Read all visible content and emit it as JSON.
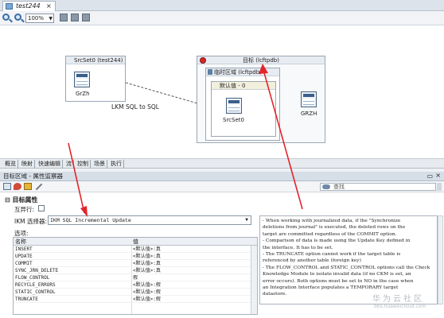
{
  "editor": {
    "tab_label": "test244",
    "tab_close": "×",
    "zoom_value": "100%"
  },
  "diagram": {
    "source_set": {
      "title": "SrcSet0 (test244)",
      "table_label": "GrZh"
    },
    "lkm_label": "LKM SQL to SQL",
    "target": {
      "title": "目标 (lcftpdb)",
      "staging_title": "临时区域 (lcftpdb)",
      "default_title": "默认值 - 0",
      "inner_table_label": "SrcSet0",
      "target_table_label": "GRZH"
    }
  },
  "view_tabs": [
    "概览",
    "映射",
    "快速编辑",
    "流",
    "控制",
    "场景",
    "执行"
  ],
  "properties_panel": {
    "header": "目标区域 - 属性监察器",
    "search_placeholder": "查找",
    "section_title": "目标属性",
    "mutex_label": "互异行:",
    "lkm_selector_label": "IKM 选择器:",
    "lkm_selected": "IKM SQL Incremental Update",
    "options_label": "选项:",
    "options_columns": {
      "name": "名称",
      "value": "值"
    },
    "options": [
      {
        "name": "INSERT",
        "value": "<默认值>:真"
      },
      {
        "name": "UPDATE",
        "value": "<默认值>:真"
      },
      {
        "name": "COMMIT",
        "value": "<默认值>:真"
      },
      {
        "name": "SYNC_JRN_DELETE",
        "value": "<默认值>:真"
      },
      {
        "name": "FLOW_CONTROL",
        "value": "假"
      },
      {
        "name": "RECYCLE_ERRORS",
        "value": "<默认值>:假"
      },
      {
        "name": "STATIC_CONTROL",
        "value": "<默认值>:假"
      },
      {
        "name": "TRUNCATE",
        "value": "<默认值>:假"
      }
    ],
    "description_lines": [
      "- When working with journalized data, if the \"Synchronize",
      "deletions from journal\" is executed, the deleted rows on the",
      "target are committed regardless of the COMMIT option.",
      "- Comparison of data is made using the Update Key defined in",
      "the interface. It has to be set.",
      "- The TRUNCATE option cannot work if the target table is",
      "referenced by another table (foreign key)",
      "- The FLOW_CONTROL and STATIC_CONTROL options call the Check",
      "Knowledge Module to isolate invalid data (if no CKM is set, an",
      "error occurs). Both options must be set to NO in the case when",
      "an Integration Interface populates a TEMPORARY target",
      "datastore."
    ]
  },
  "watermark": {
    "brand": "华为云社区",
    "url": "bbs.huaweicloud.com"
  },
  "colors": {
    "arrow_red": "#e2252b",
    "panel_header": "#d6dee7"
  }
}
